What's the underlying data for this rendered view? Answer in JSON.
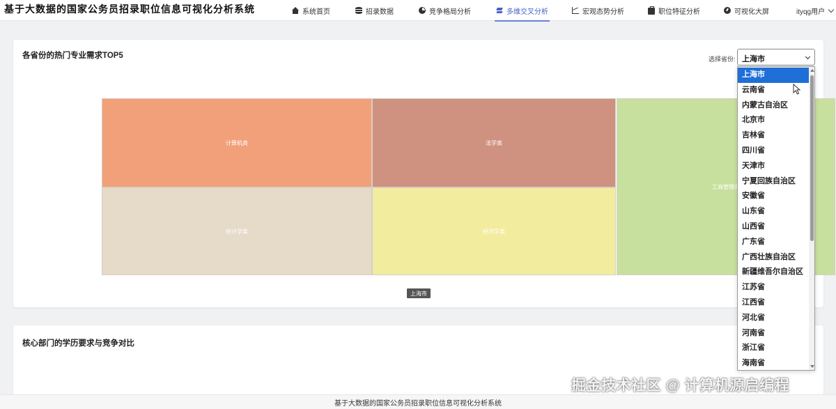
{
  "app": {
    "title": "基于大数据的国家公务员招录职位信息可视化分析系统"
  },
  "nav": {
    "items": [
      {
        "label": "系统首页",
        "icon": "home-icon"
      },
      {
        "label": "招录数据",
        "icon": "database-icon"
      },
      {
        "label": "竞争格局分析",
        "icon": "pie-chart-icon"
      },
      {
        "label": "多维交叉分析",
        "icon": "layers-icon",
        "active": true
      },
      {
        "label": "宏观态势分析",
        "icon": "line-chart-icon"
      },
      {
        "label": "职位特征分析",
        "icon": "briefcase-icon"
      },
      {
        "label": "可视化大屏",
        "icon": "dashboard-icon"
      }
    ],
    "user": "ityqg用户"
  },
  "card1": {
    "title": "各省份的热门专业需求TOP5",
    "province_label": "选择省份:",
    "province_selected": "上海市",
    "treemap": {
      "caption": "上海市",
      "cells": [
        {
          "label": "计算机类",
          "color": "#f2a07a"
        },
        {
          "label": "法学类",
          "color": "#cf9180"
        },
        {
          "label": "工商管理类",
          "color": "#c7e09e"
        },
        {
          "label": "统计学类",
          "color": "#e6dac9"
        },
        {
          "label": "经济学类",
          "color": "#f2ec9e"
        }
      ]
    }
  },
  "dropdown": {
    "options": [
      "上海市",
      "云南省",
      "内蒙古自治区",
      "北京市",
      "吉林省",
      "四川省",
      "天津市",
      "宁夏回族自治区",
      "安徽省",
      "山东省",
      "山西省",
      "广东省",
      "广西壮族自治区",
      "新疆维吾尔自治区",
      "江苏省",
      "江西省",
      "河北省",
      "河南省",
      "浙江省",
      "海南省"
    ]
  },
  "card2": {
    "title": "核心部门的学历要求与竞争对比"
  },
  "watermark": "掘金技术社区 @ 计算机源启编程",
  "footer": "基于大数据的国家公务员招录职位信息可视化分析系统",
  "colors": {
    "accent": "#4a62c8",
    "selected": "#1f6fd8"
  }
}
